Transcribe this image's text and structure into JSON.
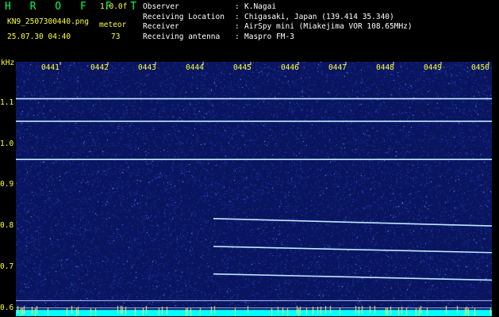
{
  "header": {
    "app_title": "H R O F F T",
    "version": "1.0.0f",
    "filename": "KN9_2507300440.png",
    "meteor_label": "meteor",
    "meteor_count": "73",
    "timestamp": "25.07.30 04:40"
  },
  "meta": [
    {
      "key": "Observer",
      "value": "K.Nagai"
    },
    {
      "key": "Receiving Location",
      "value": "Chigasaki, Japan (139.414 35.340)"
    },
    {
      "key": "Receiver",
      "value": "AirSpy mini (Miakejima VOR 108.65MHz)"
    },
    {
      "key": "Receiving antenna",
      "value": "Maspro FM-3"
    }
  ],
  "spectrogram": {
    "y_unit": "kHz",
    "y_ticks": [
      "1.1",
      "1.0",
      "0.9",
      "0.8",
      "0.7",
      "0.6"
    ],
    "y_tick_values": [
      1.1,
      1.0,
      0.9,
      0.8,
      0.7,
      0.6
    ],
    "y_range": [
      0.58,
      1.2
    ],
    "time_labels": [
      "0441",
      "0442",
      "0443",
      "0444",
      "0445",
      "0446",
      "0447",
      "0448",
      "0449",
      "0450"
    ],
    "time_range_min": [
      0,
      10
    ],
    "carriers": [
      {
        "freq_start": 1.11,
        "freq_end": 1.11,
        "t_start": 0,
        "t_end": 10
      },
      {
        "freq_start": 1.055,
        "freq_end": 1.055,
        "t_start": 0,
        "t_end": 10
      },
      {
        "freq_start": 0.962,
        "freq_end": 0.962,
        "t_start": 0,
        "t_end": 10
      },
      {
        "freq_start": 0.818,
        "freq_end": 0.8,
        "t_start": 4.15,
        "t_end": 10
      },
      {
        "freq_start": 0.75,
        "freq_end": 0.735,
        "t_start": 4.15,
        "t_end": 10
      },
      {
        "freq_start": 0.683,
        "freq_end": 0.668,
        "t_start": 4.15,
        "t_end": 10
      }
    ],
    "reference_lines": [
      0.618,
      0.6
    ],
    "colors": {
      "background": "#0a1560",
      "noise": "#2a4fd0",
      "carrier": "#bfe8ff",
      "axis_text": "#ffff33",
      "bottom_bar": "#00ffff"
    }
  }
}
